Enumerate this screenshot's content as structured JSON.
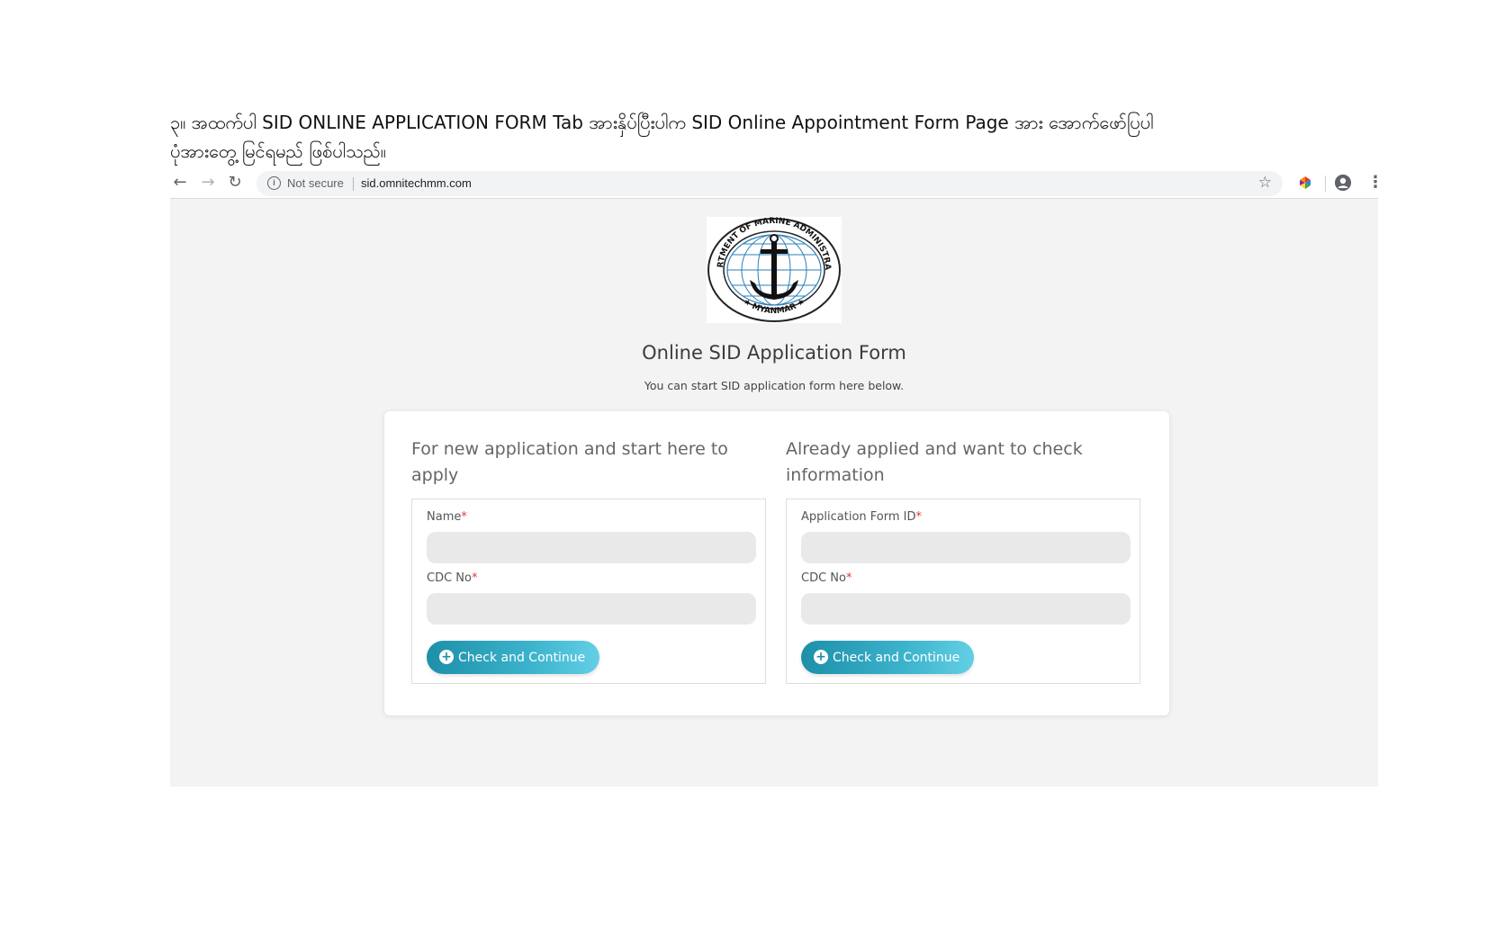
{
  "instruction": {
    "line1": "၃။ အထက်ပါ SID ONLINE APPLICATION FORM Tab အားနှိပ်ပြီးပါက SID Online Appointment Form Page အား အောက်ဖော်ပြပါ",
    "line2": "ပုံအားတွေ့ မြင်ရမည် ဖြစ်ပါသည်။"
  },
  "browser": {
    "not_secure": "Not secure",
    "url": "sid.omnitechmm.com"
  },
  "logo": {
    "top_text": "DEPARTMENT OF MARINE ADMINISTRATION",
    "bottom_text": "★ MYANMAR ★"
  },
  "page": {
    "title": "Online SID Application Form",
    "subtitle": "You can start SID application form here below."
  },
  "new_application": {
    "heading": "For new application and start here to apply",
    "name_label": "Name",
    "cdc_label": "CDC No",
    "required_mark": "*",
    "button_label": "Check and Continue"
  },
  "check_application": {
    "heading": "Already applied and want to check information",
    "form_id_label": "Application Form ID",
    "cdc_label": "CDC No",
    "required_mark": "*",
    "button_label": "Check and Continue"
  },
  "colors": {
    "accent_start": "#1d8fa9",
    "accent_end": "#63cfe6",
    "required": "#e0383e"
  }
}
